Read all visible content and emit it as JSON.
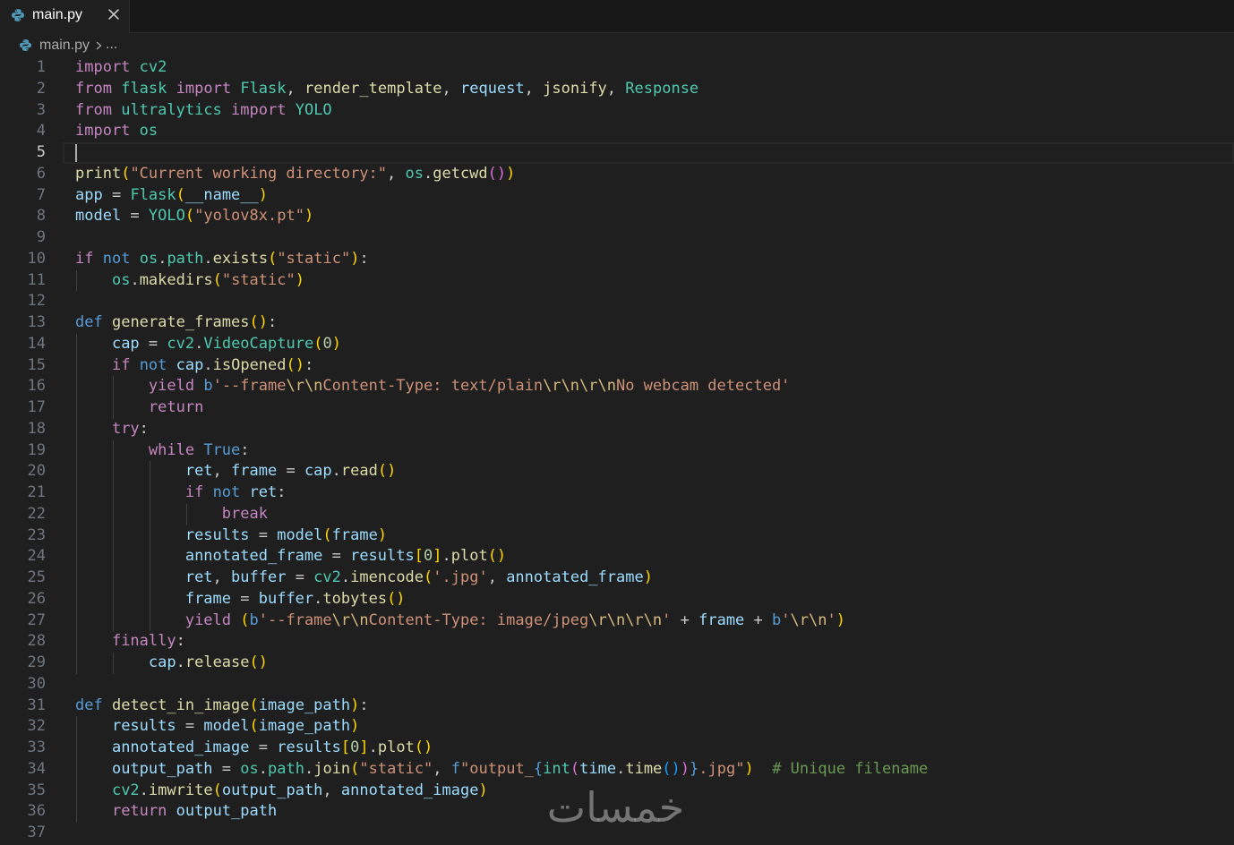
{
  "tabs": [
    {
      "label": "main.py",
      "icon": "python-file-icon",
      "active": true
    }
  ],
  "breadcrumb": {
    "icon": "python-file-icon",
    "file": "main.py",
    "separator_icon": "chevron-right-icon",
    "more": "..."
  },
  "editor": {
    "cursor_line": 5,
    "syntax_colors": {
      "keyword": "#c586c0",
      "storage": "#569cd6",
      "type": "#4ec9b0",
      "func": "#dcdcaa",
      "var": "#9cdcfe",
      "string": "#ce9178",
      "escape": "#d7ba7d",
      "number": "#b5cea8",
      "plain": "#cccccc",
      "bracket1": "#ffd700",
      "bracket2": "#da70d6",
      "bracket3": "#179fff",
      "comment": "#6a9955",
      "interp": "#569cd6"
    },
    "lines": [
      {
        "n": 1,
        "tokens": [
          [
            "import",
            "keyword"
          ],
          [
            " ",
            "plain"
          ],
          [
            "cv2",
            "type"
          ]
        ]
      },
      {
        "n": 2,
        "tokens": [
          [
            "from",
            "keyword"
          ],
          [
            " ",
            "plain"
          ],
          [
            "flask",
            "type"
          ],
          [
            " ",
            "plain"
          ],
          [
            "import",
            "keyword"
          ],
          [
            " ",
            "plain"
          ],
          [
            "Flask",
            "type"
          ],
          [
            ", ",
            "plain"
          ],
          [
            "render_template",
            "func"
          ],
          [
            ", ",
            "plain"
          ],
          [
            "request",
            "var"
          ],
          [
            ", ",
            "plain"
          ],
          [
            "jsonify",
            "func"
          ],
          [
            ", ",
            "plain"
          ],
          [
            "Response",
            "type"
          ]
        ]
      },
      {
        "n": 3,
        "tokens": [
          [
            "from",
            "keyword"
          ],
          [
            " ",
            "plain"
          ],
          [
            "ultralytics",
            "type"
          ],
          [
            " ",
            "plain"
          ],
          [
            "import",
            "keyword"
          ],
          [
            " ",
            "plain"
          ],
          [
            "YOLO",
            "type"
          ]
        ]
      },
      {
        "n": 4,
        "tokens": [
          [
            "import",
            "keyword"
          ],
          [
            " ",
            "plain"
          ],
          [
            "os",
            "type"
          ]
        ]
      },
      {
        "n": 5,
        "tokens": []
      },
      {
        "n": 6,
        "tokens": [
          [
            "print",
            "func"
          ],
          [
            "(",
            "bracket1"
          ],
          [
            "\"Current working directory:\"",
            "string"
          ],
          [
            ", ",
            "plain"
          ],
          [
            "os",
            "type"
          ],
          [
            ".",
            "plain"
          ],
          [
            "getcwd",
            "func"
          ],
          [
            "()",
            "bracket2"
          ],
          [
            ")",
            "bracket1"
          ]
        ]
      },
      {
        "n": 7,
        "tokens": [
          [
            "app",
            "var"
          ],
          [
            " = ",
            "plain"
          ],
          [
            "Flask",
            "type"
          ],
          [
            "(",
            "bracket1"
          ],
          [
            "__name__",
            "var"
          ],
          [
            ")",
            "bracket1"
          ]
        ]
      },
      {
        "n": 8,
        "tokens": [
          [
            "model",
            "var"
          ],
          [
            " = ",
            "plain"
          ],
          [
            "YOLO",
            "type"
          ],
          [
            "(",
            "bracket1"
          ],
          [
            "\"yolov8x.pt\"",
            "string"
          ],
          [
            ")",
            "bracket1"
          ]
        ]
      },
      {
        "n": 9,
        "tokens": []
      },
      {
        "n": 10,
        "tokens": [
          [
            "if",
            "keyword"
          ],
          [
            " ",
            "plain"
          ],
          [
            "not",
            "storage"
          ],
          [
            " ",
            "plain"
          ],
          [
            "os",
            "type"
          ],
          [
            ".",
            "plain"
          ],
          [
            "path",
            "type"
          ],
          [
            ".",
            "plain"
          ],
          [
            "exists",
            "func"
          ],
          [
            "(",
            "bracket1"
          ],
          [
            "\"static\"",
            "string"
          ],
          [
            ")",
            "bracket1"
          ],
          [
            ":",
            "plain"
          ]
        ]
      },
      {
        "n": 11,
        "tokens": [
          [
            "    ",
            "plain"
          ],
          [
            "os",
            "type"
          ],
          [
            ".",
            "plain"
          ],
          [
            "makedirs",
            "func"
          ],
          [
            "(",
            "bracket1"
          ],
          [
            "\"static\"",
            "string"
          ],
          [
            ")",
            "bracket1"
          ]
        ]
      },
      {
        "n": 12,
        "tokens": []
      },
      {
        "n": 13,
        "tokens": [
          [
            "def",
            "storage"
          ],
          [
            " ",
            "plain"
          ],
          [
            "generate_frames",
            "func"
          ],
          [
            "()",
            "bracket1"
          ],
          [
            ":",
            "plain"
          ]
        ]
      },
      {
        "n": 14,
        "tokens": [
          [
            "    ",
            "plain"
          ],
          [
            "cap",
            "var"
          ],
          [
            " = ",
            "plain"
          ],
          [
            "cv2",
            "type"
          ],
          [
            ".",
            "plain"
          ],
          [
            "VideoCapture",
            "type"
          ],
          [
            "(",
            "bracket1"
          ],
          [
            "0",
            "number"
          ],
          [
            ")",
            "bracket1"
          ]
        ]
      },
      {
        "n": 15,
        "tokens": [
          [
            "    ",
            "plain"
          ],
          [
            "if",
            "keyword"
          ],
          [
            " ",
            "plain"
          ],
          [
            "not",
            "storage"
          ],
          [
            " ",
            "plain"
          ],
          [
            "cap",
            "var"
          ],
          [
            ".",
            "plain"
          ],
          [
            "isOpened",
            "func"
          ],
          [
            "()",
            "bracket1"
          ],
          [
            ":",
            "plain"
          ]
        ]
      },
      {
        "n": 16,
        "tokens": [
          [
            "        ",
            "plain"
          ],
          [
            "yield",
            "keyword"
          ],
          [
            " ",
            "plain"
          ],
          [
            "b",
            "storage"
          ],
          [
            "'--frame",
            "string"
          ],
          [
            "\\r\\n",
            "escape"
          ],
          [
            "Content-Type: text/plain",
            "string"
          ],
          [
            "\\r\\n\\r\\n",
            "escape"
          ],
          [
            "No webcam detected'",
            "string"
          ]
        ]
      },
      {
        "n": 17,
        "tokens": [
          [
            "        ",
            "plain"
          ],
          [
            "return",
            "keyword"
          ]
        ]
      },
      {
        "n": 18,
        "tokens": [
          [
            "    ",
            "plain"
          ],
          [
            "try",
            "keyword"
          ],
          [
            ":",
            "plain"
          ]
        ]
      },
      {
        "n": 19,
        "tokens": [
          [
            "        ",
            "plain"
          ],
          [
            "while",
            "keyword"
          ],
          [
            " ",
            "plain"
          ],
          [
            "True",
            "storage"
          ],
          [
            ":",
            "plain"
          ]
        ]
      },
      {
        "n": 20,
        "tokens": [
          [
            "            ",
            "plain"
          ],
          [
            "ret",
            "var"
          ],
          [
            ", ",
            "plain"
          ],
          [
            "frame",
            "var"
          ],
          [
            " = ",
            "plain"
          ],
          [
            "cap",
            "var"
          ],
          [
            ".",
            "plain"
          ],
          [
            "read",
            "func"
          ],
          [
            "()",
            "bracket1"
          ]
        ]
      },
      {
        "n": 21,
        "tokens": [
          [
            "            ",
            "plain"
          ],
          [
            "if",
            "keyword"
          ],
          [
            " ",
            "plain"
          ],
          [
            "not",
            "storage"
          ],
          [
            " ",
            "plain"
          ],
          [
            "ret",
            "var"
          ],
          [
            ":",
            "plain"
          ]
        ]
      },
      {
        "n": 22,
        "tokens": [
          [
            "                ",
            "plain"
          ],
          [
            "break",
            "keyword"
          ]
        ]
      },
      {
        "n": 23,
        "tokens": [
          [
            "            ",
            "plain"
          ],
          [
            "results",
            "var"
          ],
          [
            " = ",
            "plain"
          ],
          [
            "model",
            "var"
          ],
          [
            "(",
            "bracket1"
          ],
          [
            "frame",
            "var"
          ],
          [
            ")",
            "bracket1"
          ]
        ]
      },
      {
        "n": 24,
        "tokens": [
          [
            "            ",
            "plain"
          ],
          [
            "annotated_frame",
            "var"
          ],
          [
            " = ",
            "plain"
          ],
          [
            "results",
            "var"
          ],
          [
            "[",
            "bracket1"
          ],
          [
            "0",
            "number"
          ],
          [
            "]",
            "bracket1"
          ],
          [
            ".",
            "plain"
          ],
          [
            "plot",
            "func"
          ],
          [
            "()",
            "bracket1"
          ]
        ]
      },
      {
        "n": 25,
        "tokens": [
          [
            "            ",
            "plain"
          ],
          [
            "ret",
            "var"
          ],
          [
            ", ",
            "plain"
          ],
          [
            "buffer",
            "var"
          ],
          [
            " = ",
            "plain"
          ],
          [
            "cv2",
            "type"
          ],
          [
            ".",
            "plain"
          ],
          [
            "imencode",
            "func"
          ],
          [
            "(",
            "bracket1"
          ],
          [
            "'.jpg'",
            "string"
          ],
          [
            ", ",
            "plain"
          ],
          [
            "annotated_frame",
            "var"
          ],
          [
            ")",
            "bracket1"
          ]
        ]
      },
      {
        "n": 26,
        "tokens": [
          [
            "            ",
            "plain"
          ],
          [
            "frame",
            "var"
          ],
          [
            " = ",
            "plain"
          ],
          [
            "buffer",
            "var"
          ],
          [
            ".",
            "plain"
          ],
          [
            "tobytes",
            "func"
          ],
          [
            "()",
            "bracket1"
          ]
        ]
      },
      {
        "n": 27,
        "tokens": [
          [
            "            ",
            "plain"
          ],
          [
            "yield",
            "keyword"
          ],
          [
            " ",
            "plain"
          ],
          [
            "(",
            "bracket1"
          ],
          [
            "b",
            "storage"
          ],
          [
            "'--frame",
            "string"
          ],
          [
            "\\r\\n",
            "escape"
          ],
          [
            "Content-Type: image/jpeg",
            "string"
          ],
          [
            "\\r\\n\\r\\n",
            "escape"
          ],
          [
            "'",
            "string"
          ],
          [
            " + ",
            "plain"
          ],
          [
            "frame",
            "var"
          ],
          [
            " + ",
            "plain"
          ],
          [
            "b",
            "storage"
          ],
          [
            "'",
            "string"
          ],
          [
            "\\r\\n",
            "escape"
          ],
          [
            "'",
            "string"
          ],
          [
            ")",
            "bracket1"
          ]
        ]
      },
      {
        "n": 28,
        "tokens": [
          [
            "    ",
            "plain"
          ],
          [
            "finally",
            "keyword"
          ],
          [
            ":",
            "plain"
          ]
        ]
      },
      {
        "n": 29,
        "tokens": [
          [
            "        ",
            "plain"
          ],
          [
            "cap",
            "var"
          ],
          [
            ".",
            "plain"
          ],
          [
            "release",
            "func"
          ],
          [
            "()",
            "bracket1"
          ]
        ]
      },
      {
        "n": 30,
        "tokens": []
      },
      {
        "n": 31,
        "tokens": [
          [
            "def",
            "storage"
          ],
          [
            " ",
            "plain"
          ],
          [
            "detect_in_image",
            "func"
          ],
          [
            "(",
            "bracket1"
          ],
          [
            "image_path",
            "var"
          ],
          [
            ")",
            "bracket1"
          ],
          [
            ":",
            "plain"
          ]
        ]
      },
      {
        "n": 32,
        "tokens": [
          [
            "    ",
            "plain"
          ],
          [
            "results",
            "var"
          ],
          [
            " = ",
            "plain"
          ],
          [
            "model",
            "var"
          ],
          [
            "(",
            "bracket1"
          ],
          [
            "image_path",
            "var"
          ],
          [
            ")",
            "bracket1"
          ]
        ]
      },
      {
        "n": 33,
        "tokens": [
          [
            "    ",
            "plain"
          ],
          [
            "annotated_image",
            "var"
          ],
          [
            " = ",
            "plain"
          ],
          [
            "results",
            "var"
          ],
          [
            "[",
            "bracket1"
          ],
          [
            "0",
            "number"
          ],
          [
            "]",
            "bracket1"
          ],
          [
            ".",
            "plain"
          ],
          [
            "plot",
            "func"
          ],
          [
            "()",
            "bracket1"
          ]
        ]
      },
      {
        "n": 34,
        "tokens": [
          [
            "    ",
            "plain"
          ],
          [
            "output_path",
            "var"
          ],
          [
            " = ",
            "plain"
          ],
          [
            "os",
            "type"
          ],
          [
            ".",
            "plain"
          ],
          [
            "path",
            "type"
          ],
          [
            ".",
            "plain"
          ],
          [
            "join",
            "func"
          ],
          [
            "(",
            "bracket1"
          ],
          [
            "\"static\"",
            "string"
          ],
          [
            ", ",
            "plain"
          ],
          [
            "f",
            "storage"
          ],
          [
            "\"output_",
            "string"
          ],
          [
            "{",
            "interp"
          ],
          [
            "int",
            "type"
          ],
          [
            "(",
            "bracket2"
          ],
          [
            "time",
            "var"
          ],
          [
            ".",
            "plain"
          ],
          [
            "time",
            "func"
          ],
          [
            "()",
            "bracket3"
          ],
          [
            ")",
            "bracket2"
          ],
          [
            "}",
            "interp"
          ],
          [
            ".jpg\"",
            "string"
          ],
          [
            ")",
            "bracket1"
          ],
          [
            "  ",
            "plain"
          ],
          [
            "# Unique filename",
            "comment"
          ]
        ]
      },
      {
        "n": 35,
        "tokens": [
          [
            "    ",
            "plain"
          ],
          [
            "cv2",
            "type"
          ],
          [
            ".",
            "plain"
          ],
          [
            "imwrite",
            "func"
          ],
          [
            "(",
            "bracket1"
          ],
          [
            "output_path",
            "var"
          ],
          [
            ", ",
            "plain"
          ],
          [
            "annotated_image",
            "var"
          ],
          [
            ")",
            "bracket1"
          ]
        ]
      },
      {
        "n": 36,
        "tokens": [
          [
            "    ",
            "plain"
          ],
          [
            "return",
            "keyword"
          ],
          [
            " ",
            "plain"
          ],
          [
            "output_path",
            "var"
          ]
        ]
      },
      {
        "n": 37,
        "tokens": []
      }
    ]
  },
  "watermark": {
    "text": "خمسات"
  }
}
